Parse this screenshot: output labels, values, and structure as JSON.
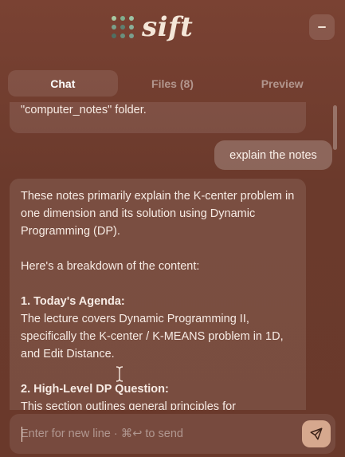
{
  "app": {
    "name": "sift"
  },
  "colors": {
    "background": "#6e3a2c",
    "logo_dots": [
      "#a7c9a2",
      "#7fae8d",
      "#9cc4a6",
      "#7aa08a",
      "#5d8071",
      "#8ab09a",
      "#4f6f62",
      "#6a8f7e",
      "#7a9f8f"
    ],
    "send_button": "#d6a88e"
  },
  "tabs": [
    {
      "label": "Chat",
      "active": true
    },
    {
      "label": "Files (8)",
      "active": false
    },
    {
      "label": "Preview",
      "active": false
    }
  ],
  "messages": {
    "previous_ai_tail": "\"computer_notes\" folder.",
    "user": "explain the notes",
    "ai": {
      "intro": "These notes primarily explain the K-center problem in one dimension and its solution using Dynamic Programming (DP).",
      "lead": "Here's a breakdown of the content:",
      "section1_title": "1. Today's Agenda:",
      "section1_body": "The lecture covers Dynamic Programming II, specifically the K-center / K-MEANS problem in 1D, and Edit Distance.",
      "section2_title": "2. High-Level DP Question:",
      "section2_body": "This section outlines general principles for"
    }
  },
  "composer": {
    "placeholder": "Enter for new line · ⌘↩ to send",
    "value": "",
    "send_icon": "paper-plane-icon"
  }
}
